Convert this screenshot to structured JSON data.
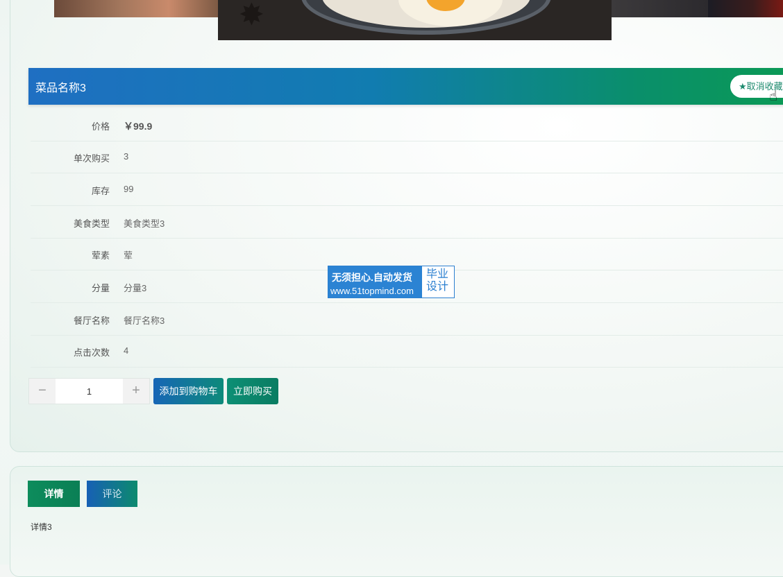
{
  "product": {
    "title": "菜品名称3",
    "favorite_label": "★取消收藏"
  },
  "details": [
    {
      "label": "价格",
      "value": "￥99.9"
    },
    {
      "label": "单次购买",
      "value": "3"
    },
    {
      "label": "库存",
      "value": "99"
    },
    {
      "label": "美食类型",
      "value": "美食类型3"
    },
    {
      "label": "荤素",
      "value": "荤"
    },
    {
      "label": "分量",
      "value": "分量3"
    },
    {
      "label": "餐厅名称",
      "value": "餐厅名称3"
    },
    {
      "label": "点击次数",
      "value": "4"
    }
  ],
  "quantity": {
    "minus": "−",
    "value": "1",
    "plus": "+"
  },
  "actions": {
    "add_to_cart": "添加到购物车",
    "buy_now": "立即购买"
  },
  "tabs": {
    "detail": "详情",
    "comment": "评论"
  },
  "detail_content": "详情3",
  "watermark": {
    "line1": "无须担心.自动发货",
    "line2": "www.51topmind.com",
    "side": "毕业设计"
  },
  "colors": {
    "title_bar_start": "#1f6fc2",
    "title_bar_end": "#0b9a55",
    "accent_green": "#0d8c5c",
    "accent_blue": "#1766b6"
  }
}
